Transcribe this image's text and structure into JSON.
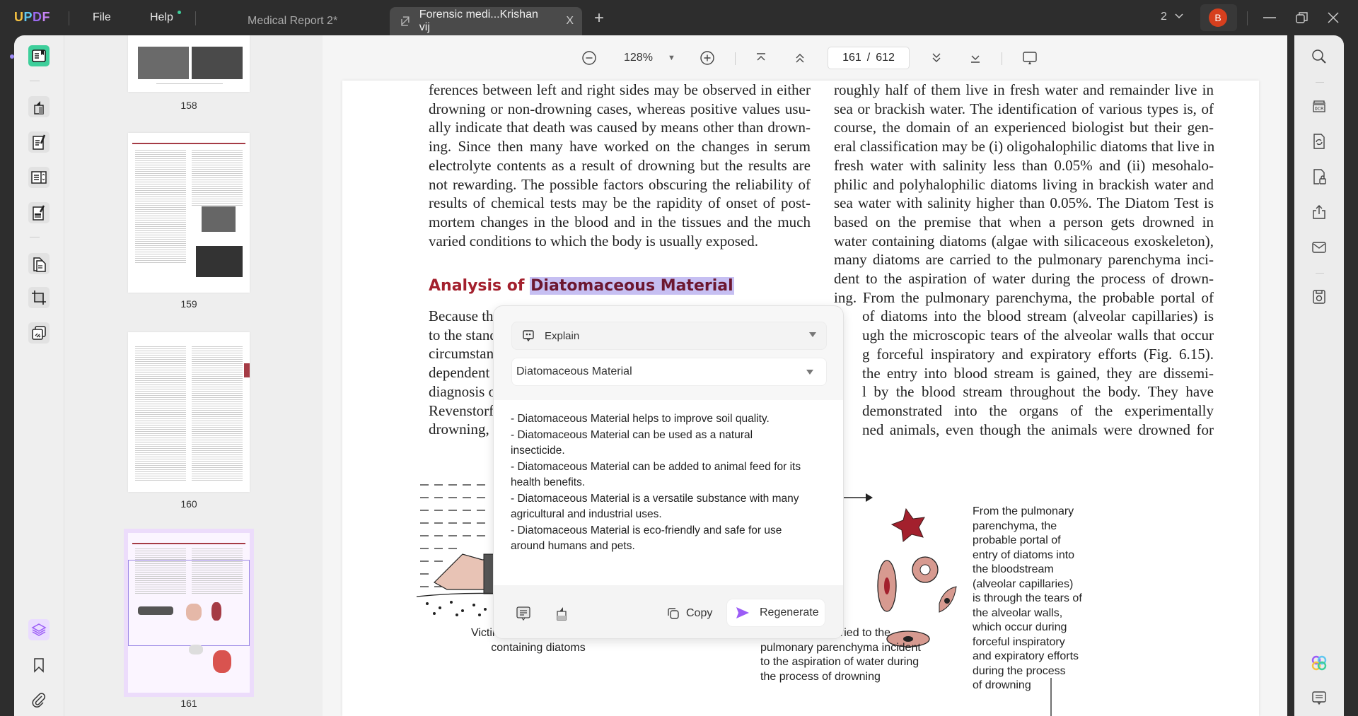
{
  "app": {
    "logo": [
      "U",
      "P",
      "D",
      "F"
    ],
    "menu": {
      "file": "File",
      "help": "Help"
    },
    "tabs": [
      {
        "label": "Medical Report 2*",
        "active": false
      },
      {
        "label": "Forensic medi...Krishan vij",
        "active": true,
        "close": "X"
      }
    ],
    "new_tab": "+",
    "window_count": "2",
    "user_initial": "B",
    "accent_color": "#3ecf9b",
    "avatar_color": "#d63f1e"
  },
  "left_toolbar": {
    "items": [
      "reader-icon",
      "highlighter-icon",
      "edit-pdf-icon",
      "organize-icon",
      "form-icon",
      "page-tools-icon",
      "crop-icon",
      "combine-icon"
    ],
    "bottom": [
      "layers-icon",
      "bookmark-icon",
      "attachment-icon"
    ]
  },
  "thumbnails": [
    {
      "page": "158"
    },
    {
      "page": "159"
    },
    {
      "page": "160"
    },
    {
      "page": "161",
      "selected": true
    }
  ],
  "doc_toolbar": {
    "zoom": "128%",
    "current_page": "161",
    "page_sep": "/",
    "total_pages": "612"
  },
  "page": {
    "left_col": [
      "ferences between left and right sides may be observed in either",
      "drowning or non-drowning cases, whereas positive values usu-",
      "ally indicate that death was caused by means other than drown-",
      "ing. Since then many have worked on the changes in serum",
      "electrolyte contents as a result of drowning but the results are",
      "not rewarding. The possible factors obscuring the reliability of",
      "results of chemical tests may be the rapidity of onset of post-",
      "mortem changes in the blood and in the tissues and the much",
      "varied conditions to which the body is usually exposed."
    ],
    "heading_prefix": "Analysis of ",
    "heading_highlight": "Diatomaceous Material",
    "left_col_2": [
      "Because the cl",
      "to the standar",
      "circumstances",
      "dependent an",
      "diagnosis  of",
      "Revenstorf, w",
      "drowning, tho"
    ],
    "right_col": [
      "roughly half of them live in fresh water and remainder live in",
      "sea or brackish water. The identification of various types is, of",
      "course, the domain of an experienced biologist but their gen-",
      "eral classification may be (i) oligohalophilic diatoms that live in",
      "fresh water with salinity less than 0.05% and (ii) mesohalo-",
      "philic and polyhalophilic diatoms living in brackish water and",
      "sea water with salinity higher than 0.05%. The Diatom Test is",
      "based on the premise that when a person gets drowned in",
      "water containing diatoms (algae with silicaceous exoskeleton),",
      "many diatoms are carried to the pulmonary parenchyma inci-",
      "dent to the aspiration of water during the process of drown-",
      "ing. From the pulmonary parenchyma, the probable portal of",
      "of diatoms into the blood stream (alveolar capillaries) is",
      "ugh the microscopic tears of the alveolar walls that occur",
      "g forceful inspiratory and expiratory efforts (Fig. 6.15).",
      "the entry into blood stream is gained, they are dissemi-",
      "l by the blood stream throughout the body. They have",
      "demonstrated into the organs of the experimentally",
      "ned animals, even though the animals were drowned for"
    ],
    "figure": {
      "caption_victim": [
        "Victim falling into the water",
        "containing diatoms"
      ],
      "caption_lungs": [
        "Diatoms are carried to the",
        "pulmonary parenchyma incident",
        "to the aspiration of water during",
        "the process of drowning"
      ],
      "caption_right": [
        "From the pulmonary",
        "parenchyma, the",
        "probable portal of",
        "entry of diatoms into",
        "the bloodstream",
        "(alveolar capillaries)",
        "is through the tears of",
        "the alveolar walls,",
        "which occur during",
        "forceful inspiratory",
        "and expiratory efforts",
        "during the process",
        "of drowning"
      ]
    }
  },
  "ai_popup": {
    "mode": "Explain",
    "term": "Diatomaceous Material",
    "response": [
      "- Diatomaceous Material helps to improve soil quality.",
      "- Diatomaceous Material can be used as a natural\ninsecticide.",
      "- Diatomaceous Material can be added to animal feed for its\nhealth benefits.",
      "- Diatomaceous Material is a versatile substance with many\nagricultural and industrial uses.",
      "- Diatomaceous Material is eco-friendly and safe for use\naround humans and pets."
    ],
    "copy_label": "Copy",
    "regenerate_label": "Regenerate",
    "regenerate_color": "#9b5cf6"
  },
  "right_toolbar": {
    "items": [
      "search-icon",
      "ocr-icon",
      "convert-icon",
      "protect-icon",
      "share-icon",
      "email-icon",
      "save-icon"
    ],
    "bottom": [
      "ai-assistant-icon",
      "comment-icon"
    ]
  }
}
